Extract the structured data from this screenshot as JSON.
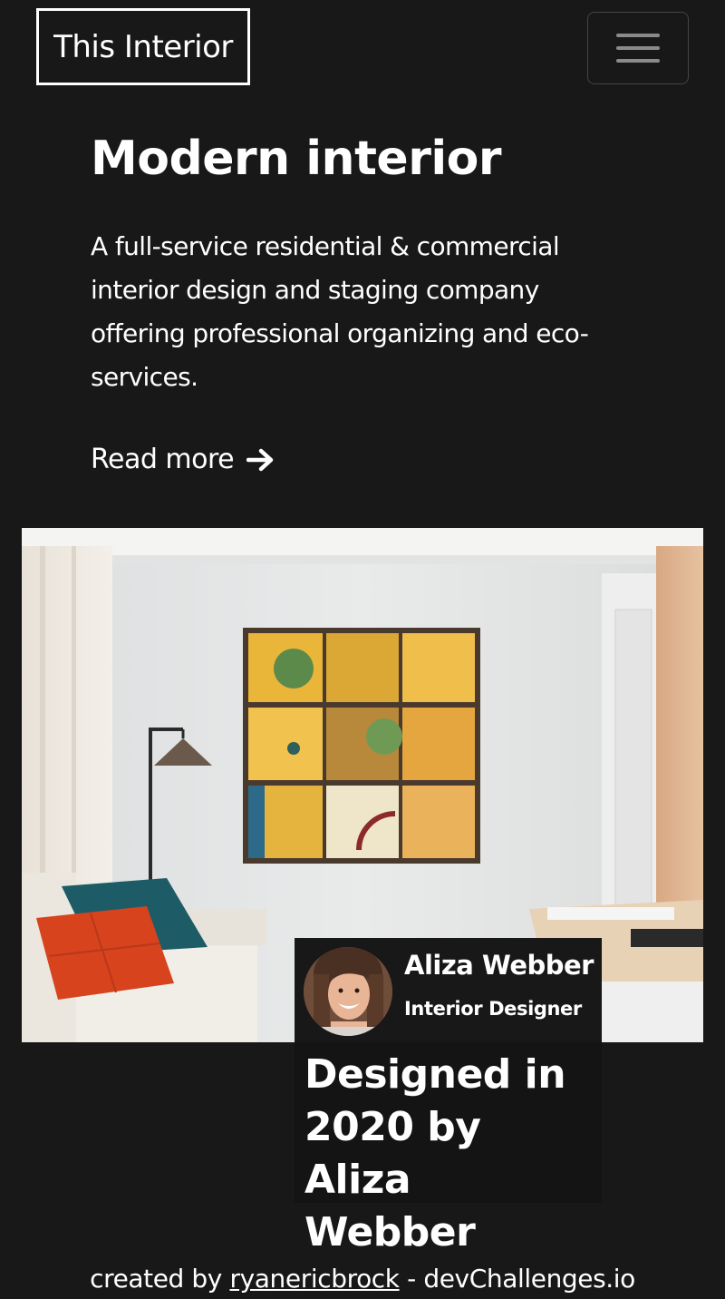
{
  "navbar": {
    "brand": "This Interior",
    "menu_icon": "hamburger-menu-icon"
  },
  "hero": {
    "title": "Modern interior",
    "description": "A full-service residential & commercial interior design and staging company offering professional organizing and eco-services.",
    "read_more_label": "Read more",
    "read_more_icon": "arrow-right-icon"
  },
  "feature": {
    "image_subject": "living-room-interior-photo",
    "designer": {
      "name": "Aliza Webber",
      "role": "Interior Designer"
    },
    "caption": "Designed in 2020 by Aliza Webber"
  },
  "footer": {
    "prefix": "created by",
    "author_link": "ryanericbrock",
    "separator": "-",
    "site": "devChallenges.io"
  },
  "colors": {
    "background": "#181818",
    "text": "#ffffff",
    "toggle_border": "#444444",
    "toggle_bars": "#8a8a8a"
  }
}
